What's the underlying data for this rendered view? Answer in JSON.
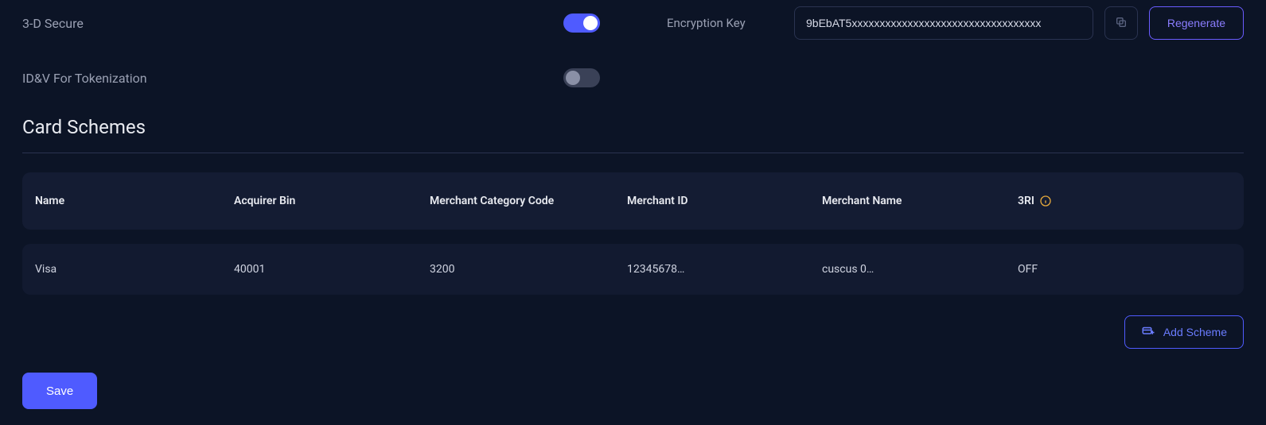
{
  "settings": {
    "three_d_secure": {
      "label": "3-D Secure",
      "on": true
    },
    "idv_tokenization": {
      "label": "ID&V For Tokenization",
      "on": false
    }
  },
  "encryption": {
    "label": "Encryption Key",
    "value": "9bEbAT5xxxxxxxxxxxxxxxxxxxxxxxxxxxxxxxxxx",
    "regenerate_label": "Regenerate"
  },
  "card_schemes": {
    "title": "Card Schemes",
    "columns": {
      "name": "Name",
      "acquirer_bin": "Acquirer Bin",
      "mcc": "Merchant Category Code",
      "merchant_id": "Merchant ID",
      "merchant_name": "Merchant Name",
      "three_ri": "3RI"
    },
    "rows": [
      {
        "name": "Visa",
        "acquirer_bin": "40001",
        "mcc": "3200",
        "merchant_id": "12345678…",
        "merchant_name": "cuscus 0…",
        "three_ri": "OFF"
      }
    ],
    "add_scheme_label": "Add Scheme"
  },
  "save_label": "Save"
}
